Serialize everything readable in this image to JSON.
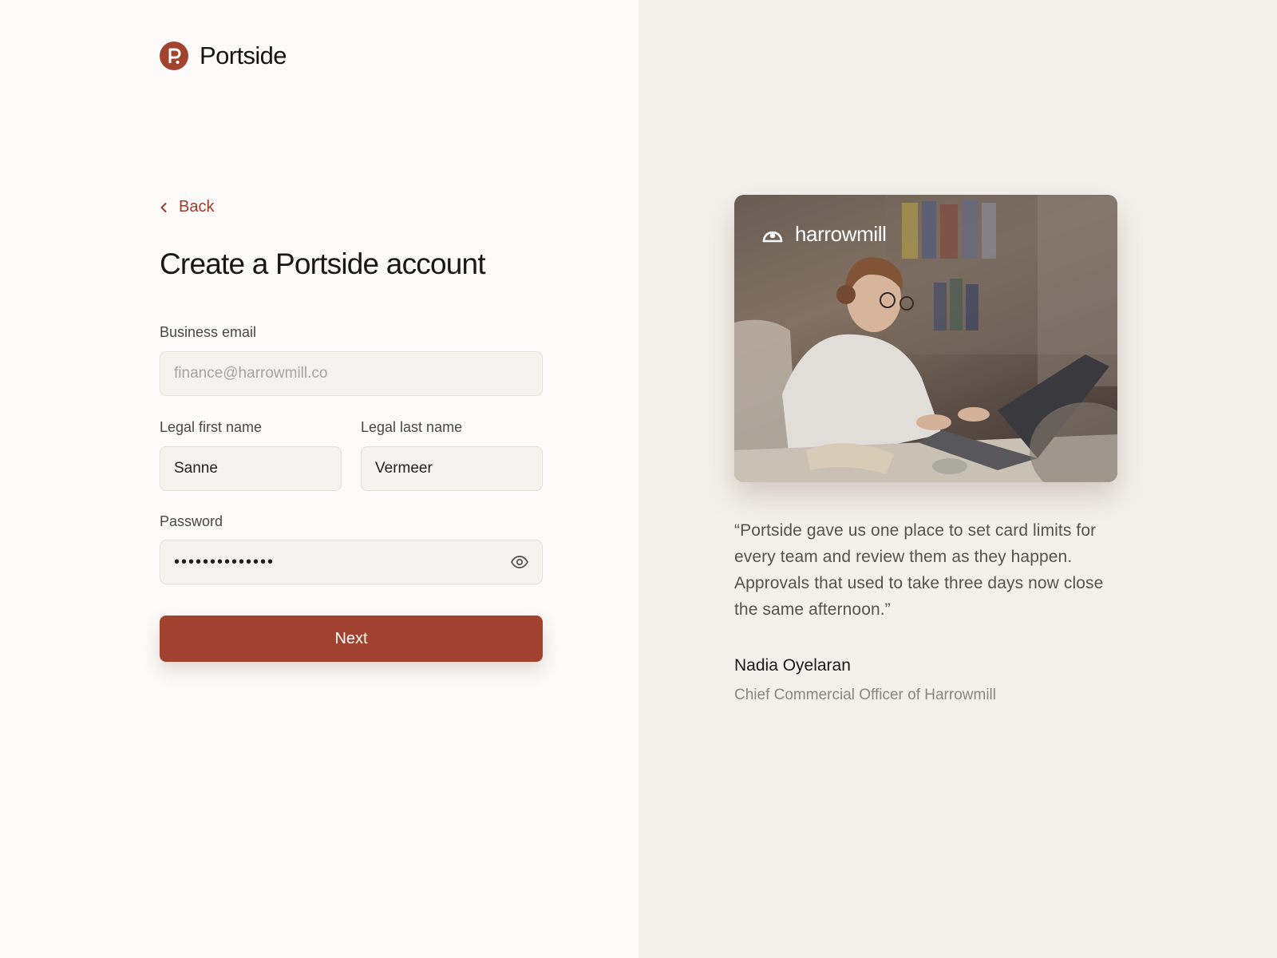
{
  "brand": {
    "name": "Portside",
    "logo_icon": "portside-p-logo-icon",
    "accent": "#a1432f"
  },
  "nav": {
    "back_label": "Back",
    "back_icon": "chevron-left-icon"
  },
  "form": {
    "title": "Create a Portside account",
    "email": {
      "label": "Business email",
      "value": "",
      "placeholder": "finance@harrowmill.co"
    },
    "first_name": {
      "label": "Legal first name",
      "value": "Sanne"
    },
    "last_name": {
      "label": "Legal last name",
      "value": "Vermeer"
    },
    "password": {
      "label": "Password",
      "masked_value": "••••••••••••••",
      "toggle_icon": "eye-icon"
    },
    "submit_label": "Next"
  },
  "testimonial": {
    "company_logo_icon": "harrowmill-logo-icon",
    "company_name": "harrowmill",
    "photo": "woman-working-at-laptop-photo",
    "quote": "“Portside gave us one place to set card limits for every team and review them as they happen. Approvals that used to take three days now close the same afternoon.”",
    "author_name": "Nadia Oyelaran",
    "author_role": "Chief Commercial Officer of Harrowmill"
  }
}
